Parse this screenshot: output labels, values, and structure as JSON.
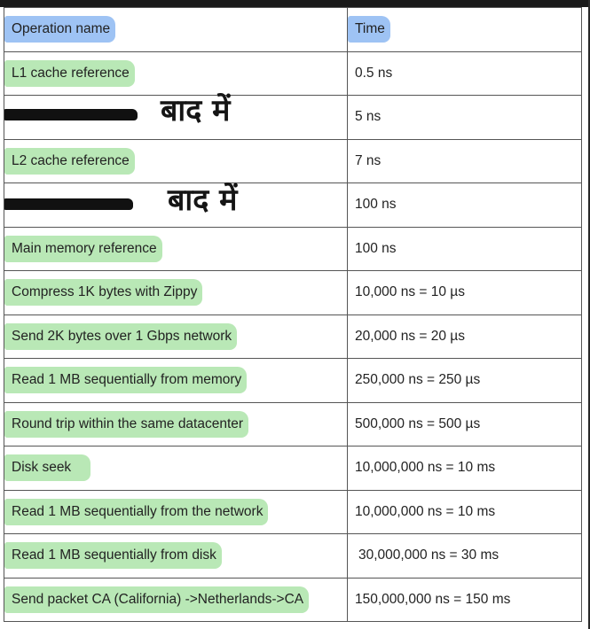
{
  "table": {
    "header": {
      "operation": "Operation name",
      "time": "Time",
      "highlight_color": "#9ec3f4"
    },
    "highlight_color": "#b9e8b6",
    "rows": [
      {
        "operation": "L1 cache reference",
        "time": "0.5 ns",
        "highlighted": true
      },
      {
        "operation": "",
        "time": "5 ns",
        "redacted": true,
        "handwritten_note": "बाद में"
      },
      {
        "operation": "L2 cache reference",
        "time": "7 ns",
        "highlighted": true
      },
      {
        "operation": "",
        "time": "100 ns",
        "redacted": true,
        "handwritten_note": "बाद में"
      },
      {
        "operation": "Main memory reference",
        "time": "100 ns",
        "highlighted": true
      },
      {
        "operation": "Compress 1K bytes with Zippy",
        "time": "10,000 ns = 10 µs",
        "highlighted": true
      },
      {
        "operation": "Send 2K bytes over 1 Gbps network",
        "time": "20,000 ns = 20 µs",
        "highlighted": true
      },
      {
        "operation": "Read 1 MB sequentially from memory",
        "time": "250,000 ns = 250 µs",
        "highlighted": true
      },
      {
        "operation": "Round trip within the same datacenter",
        "time": "500,000 ns = 500 µs",
        "highlighted": true
      },
      {
        "operation": "Disk seek",
        "time": "10,000,000 ns = 10 ms",
        "highlighted": true
      },
      {
        "operation": "Read 1 MB sequentially from the network",
        "time": "10,000,000 ns = 10 ms",
        "highlighted": true
      },
      {
        "operation": "Read 1 MB sequentially from disk",
        "time": "30,000,000 ns = 30 ms",
        "highlighted": true
      },
      {
        "operation": "Send packet CA (California) ->Netherlands->CA",
        "time": "150,000,000 ns = 150 ms",
        "highlighted": true
      }
    ]
  }
}
